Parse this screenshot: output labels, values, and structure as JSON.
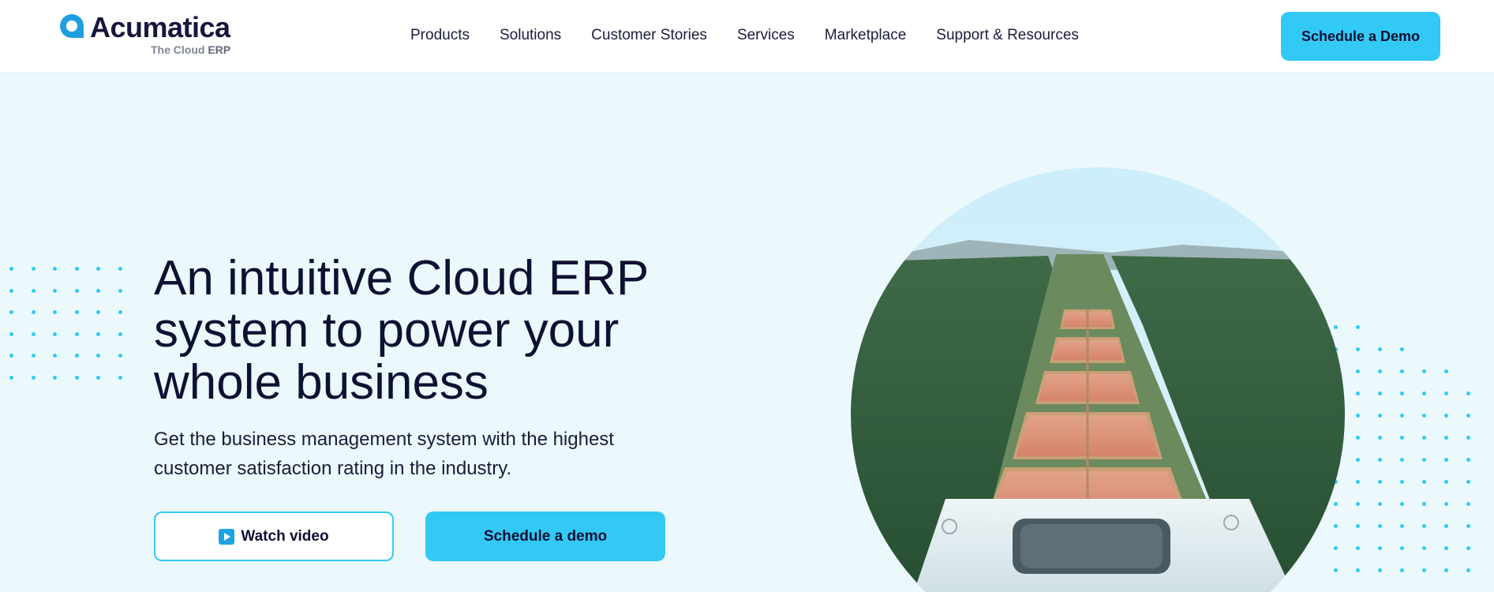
{
  "brand": {
    "name": "Acumatica",
    "tagline_prefix": "The Cloud",
    "tagline_suffix": "ERP",
    "accent_color": "#33c9f5",
    "text_color": "#0e1033"
  },
  "nav": {
    "items": [
      {
        "label": "Products"
      },
      {
        "label": "Solutions"
      },
      {
        "label": "Customer Stories"
      },
      {
        "label": "Services"
      },
      {
        "label": "Marketplace"
      },
      {
        "label": "Support & Resources"
      }
    ],
    "cta_label": "Schedule a Demo"
  },
  "hero": {
    "headline_line1": "An intuitive Cloud ERP",
    "headline_line2": "system to power your",
    "headline_line3": "whole business",
    "subhead_line1": "Get the business management system with the highest",
    "subhead_line2": "customer satisfaction rating in the industry.",
    "watch_video_label": "Watch video",
    "watch_video_icon": "play-icon",
    "schedule_demo_label": "Schedule a demo"
  }
}
